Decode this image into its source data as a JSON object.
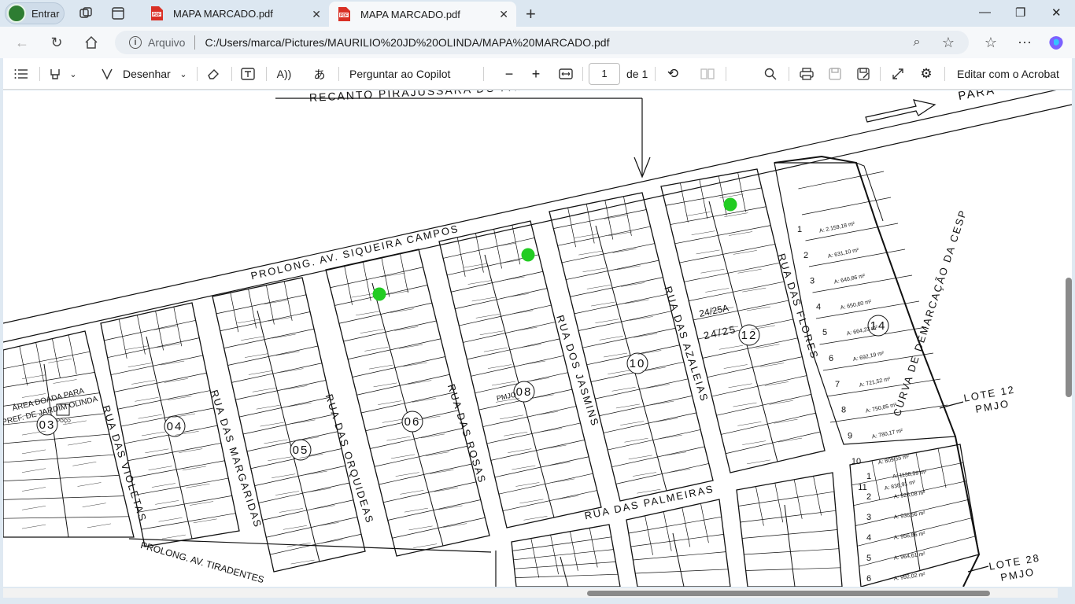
{
  "browser": {
    "profile_label": "Entrar",
    "tabs": [
      {
        "title": "MAPA MARCADO.pdf",
        "active": false
      },
      {
        "title": "MAPA MARCADO.pdf",
        "active": true
      }
    ],
    "address": {
      "origin_label": "Arquivo",
      "url": "C:/Users/marca/Pictures/MAURILIO%20JD%20OLINDA/MAPA%20MARCADO.pdf"
    }
  },
  "pdf_toolbar": {
    "draw_label": "Desenhar",
    "copilot_label": "Perguntar ao Copilot",
    "page_current": "1",
    "page_total": "de 1",
    "acrobat_label": "Editar com o Acrobat"
  },
  "map": {
    "avenue_top": "PROLONG. AV. SIQUEIRA CAMPOS",
    "avenue_top_banner": "RECANTO PIRAJUSSARA DO PARANAPANEMA",
    "arrow_label": "PARA",
    "avenue_bottom": "PROLONG. AV. TIRADENTES",
    "streets": [
      "RUA DAS VIOLETAS",
      "RUA DAS MARGARIDAS",
      "RUA DAS ORQUIDEAS",
      "RUA DAS ROSAS",
      "RUA DOS JASMINS",
      "RUA DAS AZALEIAS",
      "RUA DAS FLORES",
      "RUA DAS PALMEIRAS",
      "CURVA DE DEMARCAÇÃO DA CESP"
    ],
    "area_note": [
      "ÁREA DOADA PARA",
      "PREF. DE JARDIM OLINDA"
    ],
    "well_label": "POÇO",
    "block_numbers": [
      "03",
      "04",
      "05",
      "06",
      "08",
      "10",
      "12",
      "14"
    ],
    "lote_labels": [
      {
        "lote": "LOTE 12",
        "owner": "PMJO"
      },
      {
        "lote": "LOTE 28",
        "owner": "PMJO"
      }
    ],
    "pmjo_label": "PMJO",
    "special_lot": "24/25A",
    "special_lot_b": "24/25",
    "block14_lots": [
      {
        "n": "1",
        "area": "A: 2.159,18 m²"
      },
      {
        "n": "2",
        "area": "A: 631,10 m²"
      },
      {
        "n": "3",
        "area": "A: 640,86 m²"
      },
      {
        "n": "4",
        "area": "A: 650,60 m²"
      },
      {
        "n": "5",
        "area": "A: 664,23 m²"
      },
      {
        "n": "6",
        "area": "A: 692,19 m²"
      },
      {
        "n": "7",
        "area": "A: 721,52 m²"
      },
      {
        "n": "8",
        "area": "A: 750,85 m²"
      },
      {
        "n": "9",
        "area": "A: 780,17 m²"
      },
      {
        "n": "10",
        "area": "A: 809,55 m²"
      },
      {
        "n": "11",
        "area": "A: 838,91 m²"
      }
    ],
    "lower_right_lots": [
      {
        "n": "1",
        "area": "A: 1138,59 m²"
      },
      {
        "n": "2",
        "area": "A: 926,08 m²"
      },
      {
        "n": "3",
        "area": "A: 936,56 m²"
      },
      {
        "n": "4",
        "area": "A: 956,86 m²"
      },
      {
        "n": "5",
        "area": "A: 964,61 m²"
      },
      {
        "n": "6",
        "area": "A: 992,02 m²"
      }
    ],
    "marker_color": "#22cc22",
    "line_color": "#111111"
  }
}
